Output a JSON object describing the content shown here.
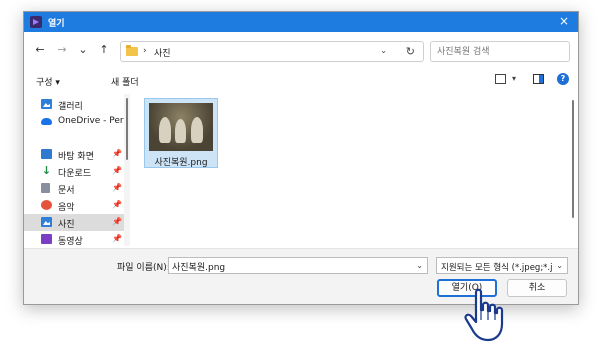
{
  "window": {
    "title": "열기",
    "close_icon": "×"
  },
  "navigation": {
    "back_icon": "←",
    "forward_icon": "→",
    "recent_icon": "⌄",
    "up_icon": "↑"
  },
  "address": {
    "separator": "›",
    "crumb": "사진",
    "dropdown_icon": "⌄",
    "refresh_icon": "↻"
  },
  "search": {
    "placeholder": "사진복원 검색"
  },
  "toolbar": {
    "organize_label": "구성 ▾",
    "new_folder_label": "새 폴더",
    "view_dropdown_icon": "▾",
    "help_icon": "?"
  },
  "sidebar": {
    "items": [
      {
        "label": "갤러리",
        "icon": "gallery-icon",
        "pinned": false
      },
      {
        "label": "OneDrive - Perso",
        "icon": "onedrive-icon",
        "pinned": false
      },
      {
        "label": "바탕 화면",
        "icon": "desktop-icon",
        "pinned": true
      },
      {
        "label": "다운로드",
        "icon": "download-icon",
        "pinned": true
      },
      {
        "label": "문서",
        "icon": "document-icon",
        "pinned": true
      },
      {
        "label": "음악",
        "icon": "music-icon",
        "pinned": true
      },
      {
        "label": "사진",
        "icon": "pictures-icon",
        "pinned": true,
        "selected": true
      },
      {
        "label": "동영상",
        "icon": "video-icon",
        "pinned": true
      }
    ],
    "pin_icon": "📌"
  },
  "files": [
    {
      "name": "사진복원.png",
      "selected": true
    }
  ],
  "footer": {
    "filename_label": "파일 이름(N):",
    "filename_value": "사진복원.png",
    "filetype_value": "지원되는 모든 형식 (*.jpeg;*.jp",
    "open_label": "열기(O)",
    "cancel_label": "취소",
    "dropdown_icon": "⌄"
  },
  "colors": {
    "titlebar": "#1e7be0",
    "accent": "#1e6fd6",
    "selection": "#cde4f7"
  }
}
